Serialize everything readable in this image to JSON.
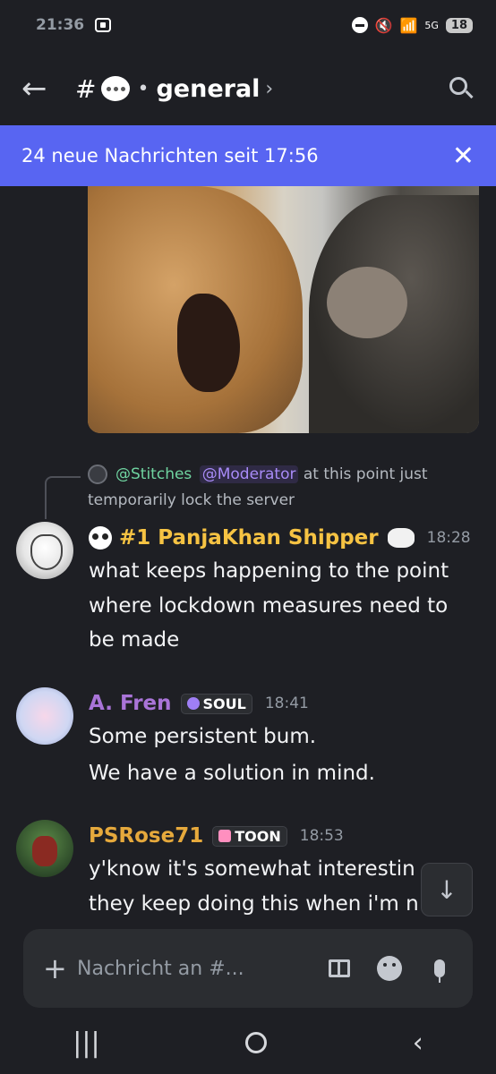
{
  "statusbar": {
    "time": "21:36",
    "battery": "18",
    "network": "5G"
  },
  "header": {
    "hash": "#",
    "title": "general",
    "chevron": "›"
  },
  "banner": {
    "text": "24 neue Nachrichten seit 17:56",
    "close": "✕"
  },
  "reply": {
    "mention_user": "@Stitches",
    "mention_role": "@Moderator",
    "text_line1": " at this point just",
    "text_line2": "temporarily lock the server"
  },
  "messages": [
    {
      "name": "#1 PanjaKhan Shipper",
      "time": "18:28",
      "lines": [
        "what keeps happening to the point",
        "where lockdown measures need to",
        "be made"
      ]
    },
    {
      "name": "A. Fren",
      "tag": "SOUL",
      "time": "18:41",
      "lines": [
        "Some persistent bum.",
        "We have a solution in mind."
      ]
    },
    {
      "name": "PSRose71",
      "tag": "TOON",
      "time": "18:53",
      "lines": [
        "y'know it's somewhat interestin",
        "they keep doing this when i'm n"
      ]
    }
  ],
  "composer": {
    "placeholder": "Nachricht an #..."
  },
  "colors": {
    "banner": "#5865f2",
    "background": "#1e1f24",
    "name1": "#f6c343",
    "name2": "#a974d8",
    "name3": "#e6a93c"
  }
}
